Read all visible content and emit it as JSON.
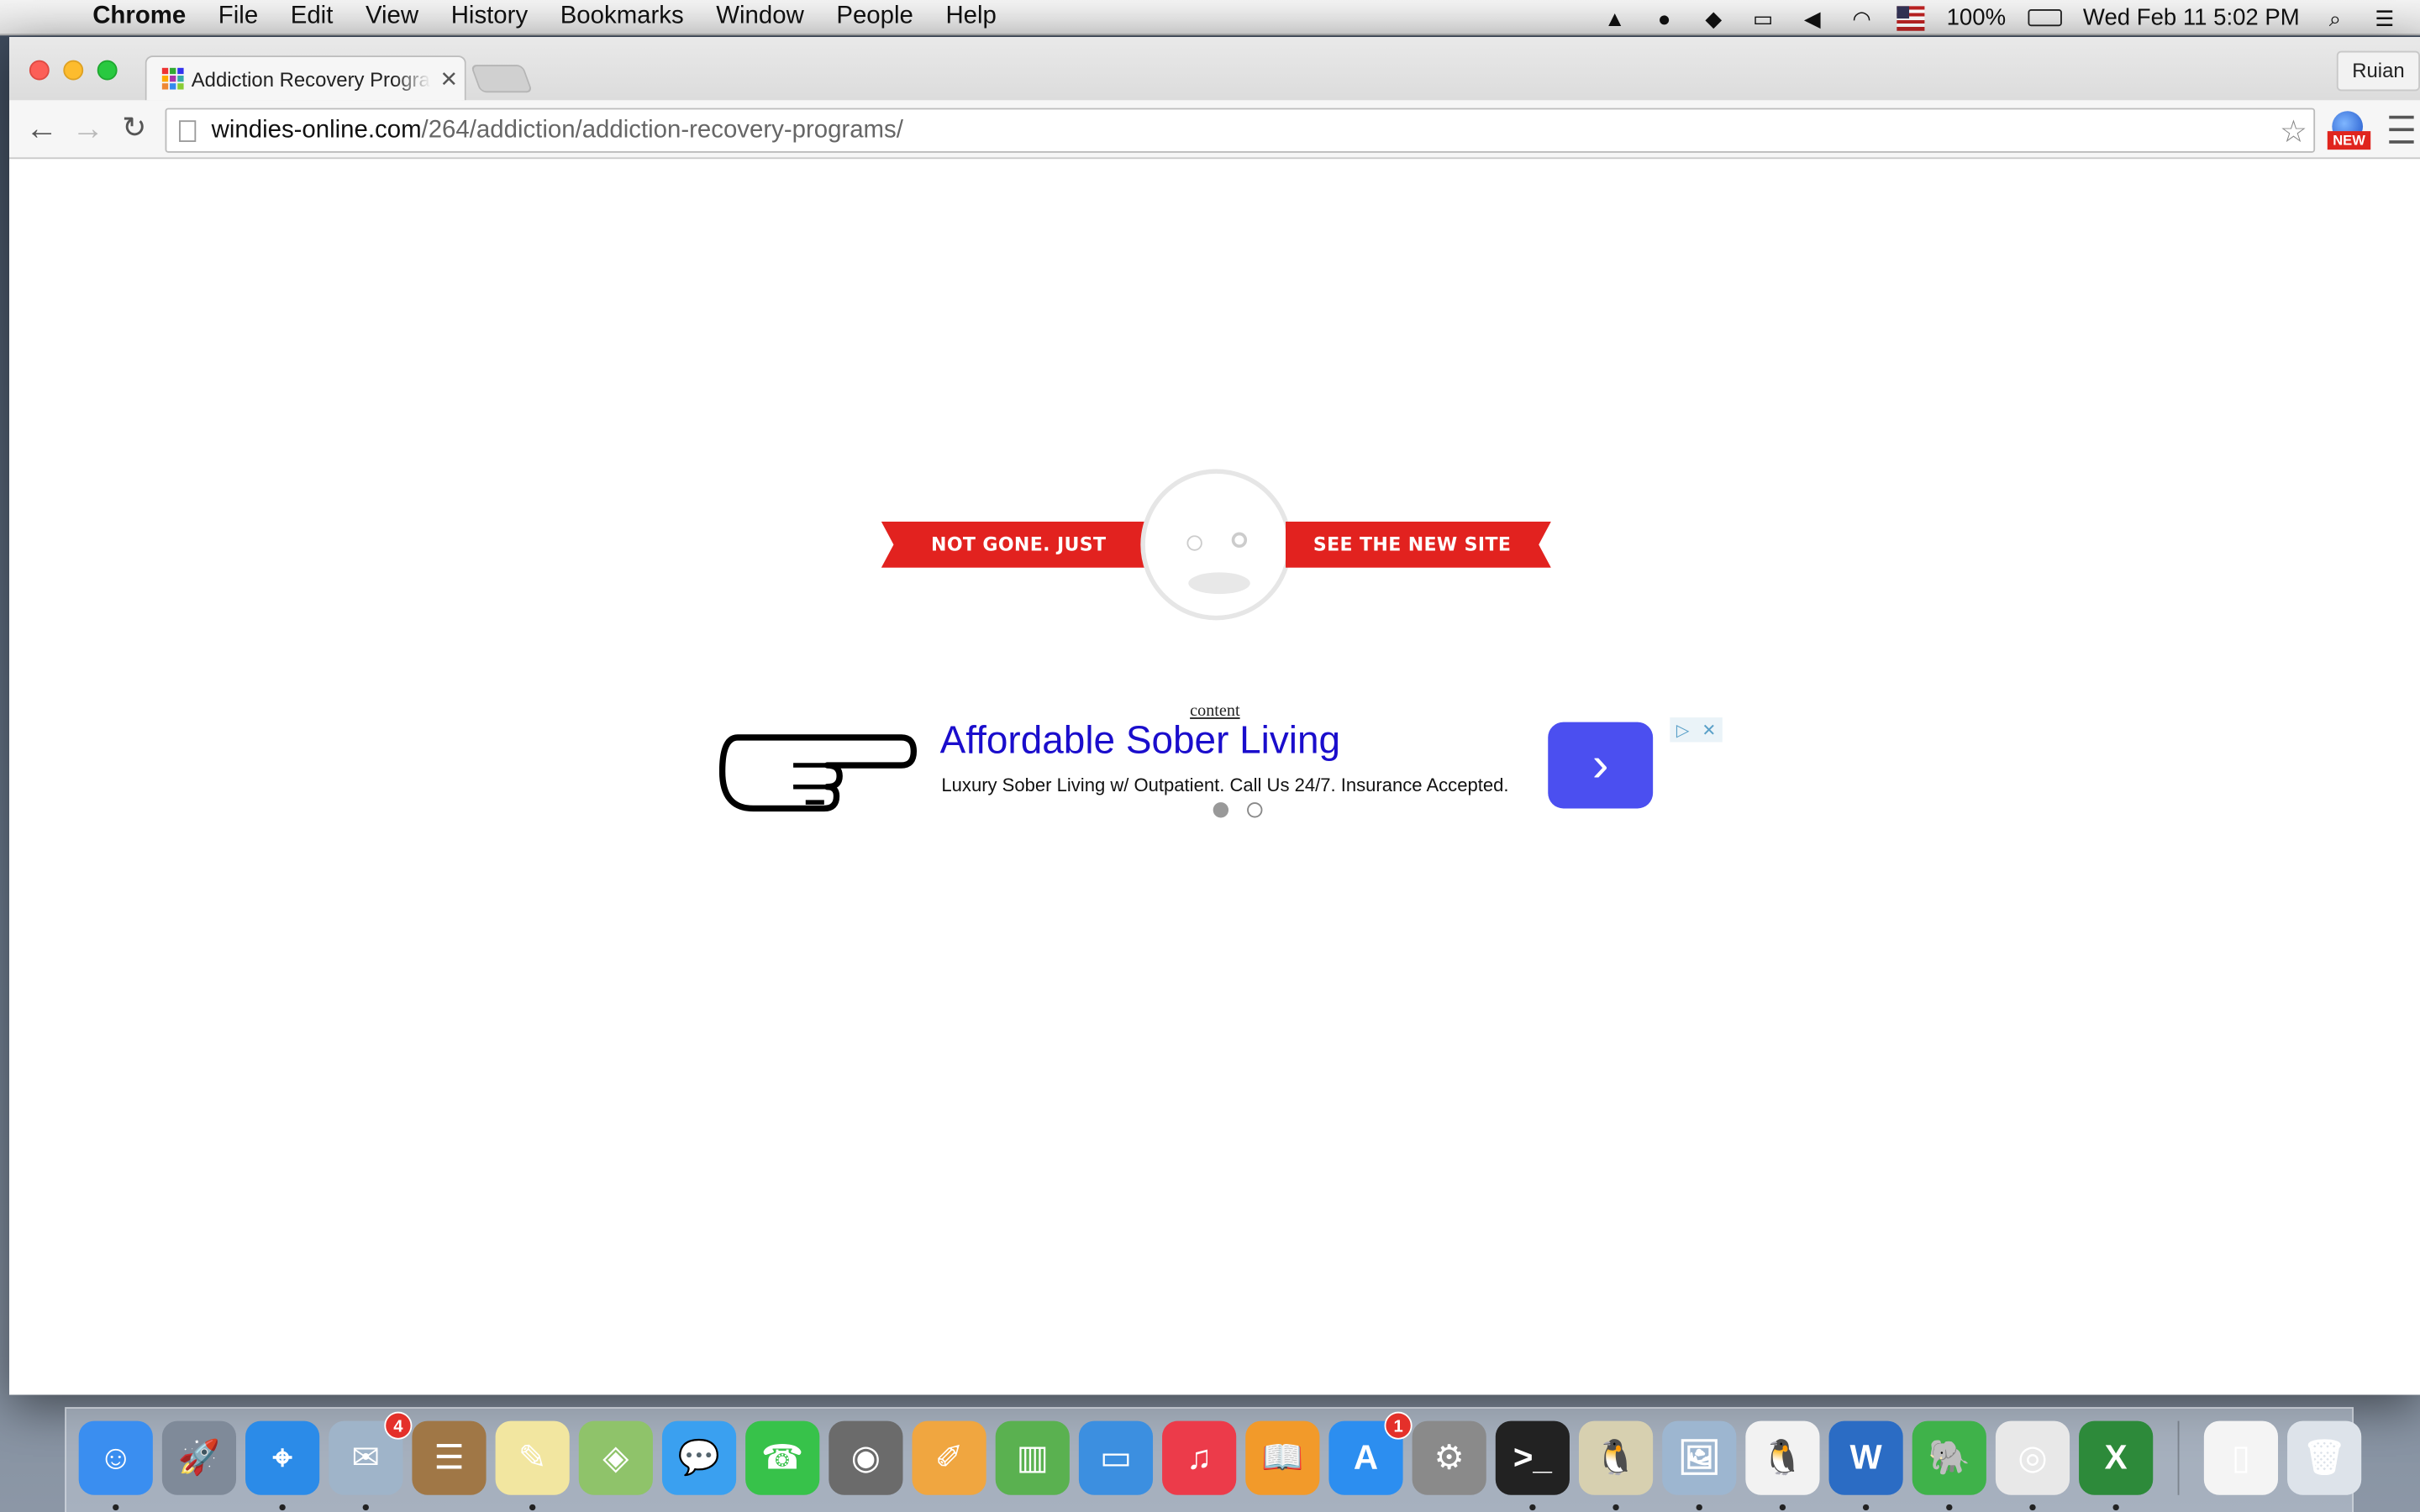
{
  "menubar": {
    "app_name": "Chrome",
    "items": [
      "File",
      "Edit",
      "View",
      "History",
      "Bookmarks",
      "Window",
      "People",
      "Help"
    ],
    "battery": "100%",
    "clock": "Wed Feb 11  5:02 PM"
  },
  "browser": {
    "tab_title": "Addiction Recovery Programs",
    "profile_name": "Ruian",
    "url_host": "windies-online.com",
    "url_path": "/264/addiction/addiction-recovery-programs/",
    "extension_badge": "NEW"
  },
  "page": {
    "ribbon_left": "NOT GONE. JUST MOVED",
    "ribbon_right": "SEE THE NEW SITE HERE",
    "content_link": "content",
    "ad": {
      "title": "Affordable Sober Living",
      "description": "Luxury Sober Living w/ Outpatient. Call Us 24/7. Insurance Accepted.",
      "carousel_position": 1,
      "carousel_total": 2
    }
  },
  "dock": {
    "apps": [
      {
        "name": "finder-icon",
        "color": "#3a8ef0",
        "glyph": "☺",
        "running": true
      },
      {
        "name": "launchpad-icon",
        "color": "#7f8a99",
        "glyph": "🚀",
        "running": false
      },
      {
        "name": "safari-icon",
        "color": "#2b8be8",
        "glyph": "⌖",
        "running": true
      },
      {
        "name": "mail-icon",
        "color": "#9fb4c9",
        "glyph": "✉",
        "running": true,
        "badge": "4"
      },
      {
        "name": "contacts-icon",
        "color": "#a07746",
        "glyph": "☰",
        "running": false
      },
      {
        "name": "notes-icon",
        "color": "#f2e6a0",
        "glyph": "✎",
        "running": true
      },
      {
        "name": "maps-icon",
        "color": "#8fc36a",
        "glyph": "◈",
        "running": false
      },
      {
        "name": "messages-icon",
        "color": "#3aa0f0",
        "glyph": "💬",
        "running": false
      },
      {
        "name": "facetime-icon",
        "color": "#37c24a",
        "glyph": "☎",
        "running": false
      },
      {
        "name": "photo-booth-icon",
        "color": "#6b6b6b",
        "glyph": "◉",
        "running": false
      },
      {
        "name": "pages-icon",
        "color": "#f0a640",
        "glyph": "✐",
        "running": false
      },
      {
        "name": "numbers-icon",
        "color": "#5ab150",
        "glyph": "▥",
        "running": false
      },
      {
        "name": "keynote-icon",
        "color": "#3c8fe0",
        "glyph": "▭",
        "running": false
      },
      {
        "name": "itunes-icon",
        "color": "#ec3b4a",
        "glyph": "♫",
        "running": false
      },
      {
        "name": "ibooks-icon",
        "color": "#f29a2a",
        "glyph": "📖",
        "running": false
      },
      {
        "name": "app-store-icon",
        "color": "#2c8ef0",
        "glyph": "A",
        "running": false,
        "badge": "1"
      },
      {
        "name": "system-preferences-icon",
        "color": "#8a8a8a",
        "glyph": "⚙",
        "running": false
      },
      {
        "name": "terminal-icon",
        "color": "#222222",
        "glyph": ">_",
        "running": true
      },
      {
        "name": "cyberduck-icon",
        "color": "#d7d0b0",
        "glyph": "🐧",
        "running": true
      },
      {
        "name": "preview-icon",
        "color": "#9db6d0",
        "glyph": "🖼",
        "running": true
      },
      {
        "name": "qq-icon",
        "color": "#f2f2f2",
        "glyph": "🐧",
        "running": true
      },
      {
        "name": "word-icon",
        "color": "#2b6cc4",
        "glyph": "W",
        "running": true
      },
      {
        "name": "evernote-icon",
        "color": "#3fb24a",
        "glyph": "🐘",
        "running": true
      },
      {
        "name": "chrome-icon",
        "color": "#e8e8e8",
        "glyph": "◎",
        "running": true
      },
      {
        "name": "excel-icon",
        "color": "#2d8a3a",
        "glyph": "X",
        "running": true
      }
    ],
    "stack": [
      {
        "name": "documents-stack-icon",
        "color": "#f4f4f4",
        "glyph": "▯"
      },
      {
        "name": "trash-icon",
        "color": "#dde3ea",
        "glyph": "🗑"
      }
    ]
  }
}
